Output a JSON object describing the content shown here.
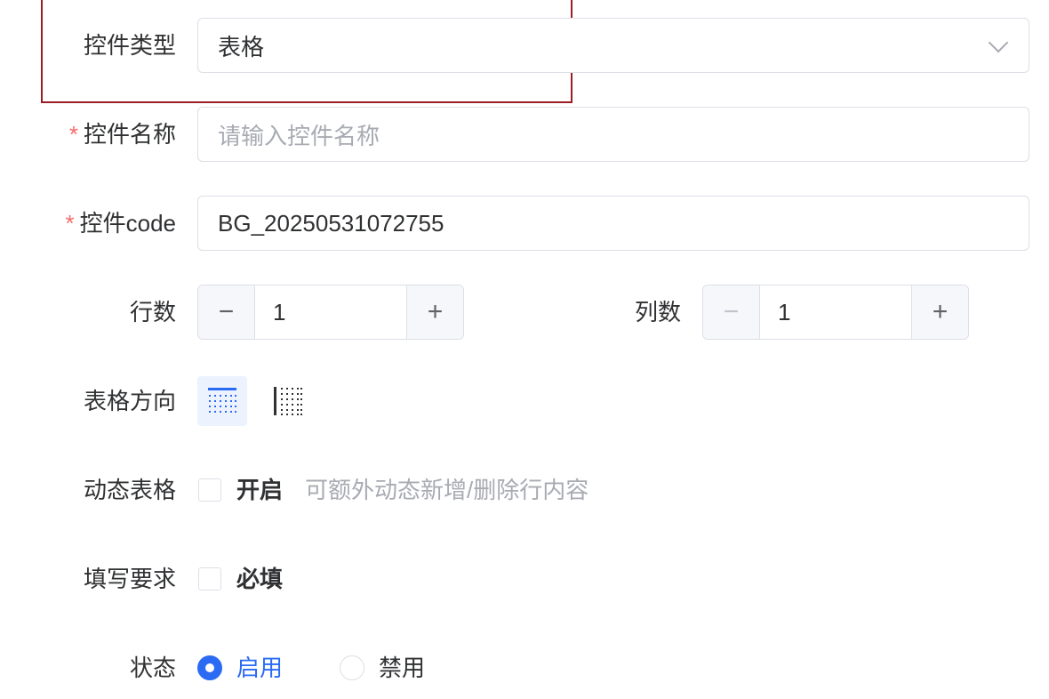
{
  "form": {
    "control_type": {
      "label": "控件类型",
      "value": "表格"
    },
    "control_name": {
      "label": "控件名称",
      "required_mark": "*",
      "placeholder": "请输入控件名称",
      "value": ""
    },
    "control_code": {
      "label": "控件code",
      "required_mark": "*",
      "value": "BG_20250531072755"
    },
    "rows": {
      "label": "行数",
      "value": "1",
      "minus": "−",
      "plus": "+"
    },
    "cols": {
      "label": "列数",
      "value": "1",
      "minus": "−",
      "plus": "+"
    },
    "direction": {
      "label": "表格方向",
      "options": [
        {
          "icon": "table-horizontal-icon",
          "selected": true
        },
        {
          "icon": "table-vertical-icon",
          "selected": false
        }
      ]
    },
    "dynamic_table": {
      "label": "动态表格",
      "checkbox_label": "开启",
      "checked": false,
      "hint": "可额外动态新增/删除行内容"
    },
    "fill_requirement": {
      "label": "填写要求",
      "checkbox_label": "必填",
      "checked": false
    },
    "status": {
      "label": "状态",
      "options": [
        {
          "label": "启用",
          "selected": true
        },
        {
          "label": "禁用",
          "selected": false
        }
      ]
    }
  },
  "colors": {
    "accent": "#2b6bf3",
    "required": "#f56c6c",
    "highlight_border": "#9b1c24",
    "placeholder": "#a8abb2",
    "border": "#dcdfe6"
  }
}
